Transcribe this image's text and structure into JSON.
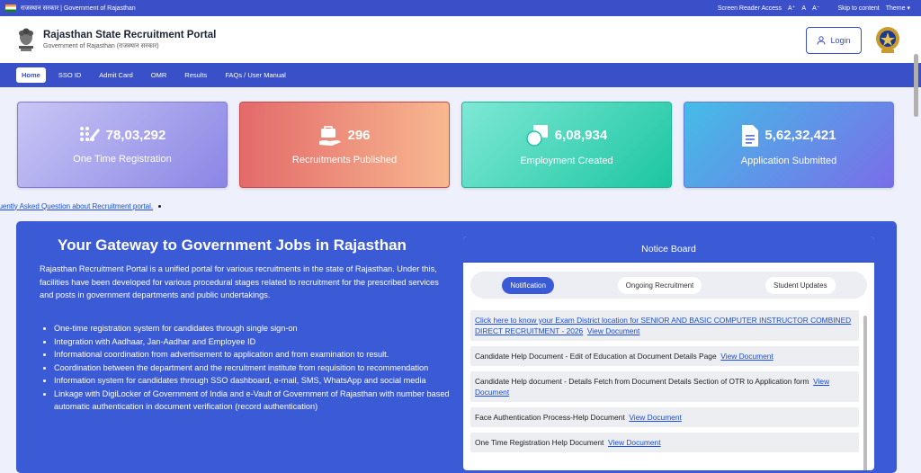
{
  "topbar": {
    "govt_label": "राजस्थान सरकार | Government of Rajasthan",
    "screen_reader": "Screen Reader Access",
    "font_inc": "A⁺",
    "font_norm": "A",
    "font_dec": "A⁻",
    "skip": "Skip to content",
    "theme": "Theme ▾"
  },
  "header": {
    "title": "Rajasthan State Recruitment Portal",
    "subtitle": "Government of Rajasthan (राजस्थान सरकार)",
    "login": "Login"
  },
  "nav": {
    "items": [
      "Home",
      "SSO ID",
      "Admit Card",
      "OMR",
      "Results",
      "FAQs / User Manual"
    ]
  },
  "stats": [
    {
      "value": "78,03,292",
      "label": "One Time Registration",
      "icon": "registration-icon"
    },
    {
      "value": "296",
      "label": "Recruitments Published",
      "icon": "briefcase-hand-icon"
    },
    {
      "value": "6,08,934",
      "label": "Employment Created",
      "icon": "employment-icon"
    },
    {
      "value": "5,62,32,421",
      "label": "Application Submitted",
      "icon": "document-icon"
    }
  ],
  "marquee": {
    "text": "quently Asked Question about Recruitment portal."
  },
  "hero": {
    "title": "Your Gateway to Government Jobs in Rajasthan",
    "intro": "Rajasthan Recruitment Portal is a unified portal for various recruitments in the state of Rajasthan. Under this, facilities have been developed for various procedural stages related to recruitment for the prescribed services and posts in government departments and public undertakings.",
    "bullets": [
      "One-time registration system for candidates through single sign-on",
      "Integration with Aadhaar, Jan-Aadhar and Employee ID",
      "Informational coordination from advertisement to application and from examination to result.",
      "Coordination between the department and the recruitment institute from requisition to recommendation",
      "Information system for candidates through SSO dashboard, e-mail, SMS, WhatsApp and social media",
      "Linkage with DigiLocker of Government of India and e-Vault of Government of Rajasthan with number based automatic authentication in document verification (record authentication)"
    ]
  },
  "notice": {
    "title": "Notice Board",
    "tabs": [
      "Notification",
      "Ongoing Recruitment",
      "Student Updates"
    ],
    "items": [
      {
        "text": "Click here to know your Exam District location for SENIOR AND BASIC COMPUTER INSTRUCTOR COMBINED DIRECT RECRUITMENT - 2026",
        "link": "View Document",
        "text_is_link": true
      },
      {
        "text": "Candidate Help Document - Edit of Education at Document Details Page",
        "link": "View Document",
        "text_is_link": false
      },
      {
        "text": "Candidate Help document - Details Fetch from Document Details Section of OTR to Application form",
        "link": "View Document",
        "text_is_link": false
      },
      {
        "text": "Face Authentication Process-Help Document",
        "link": "View Document",
        "text_is_link": false
      },
      {
        "text": "One Time Registration Help Document",
        "link": "View Document",
        "text_is_link": false
      }
    ]
  }
}
